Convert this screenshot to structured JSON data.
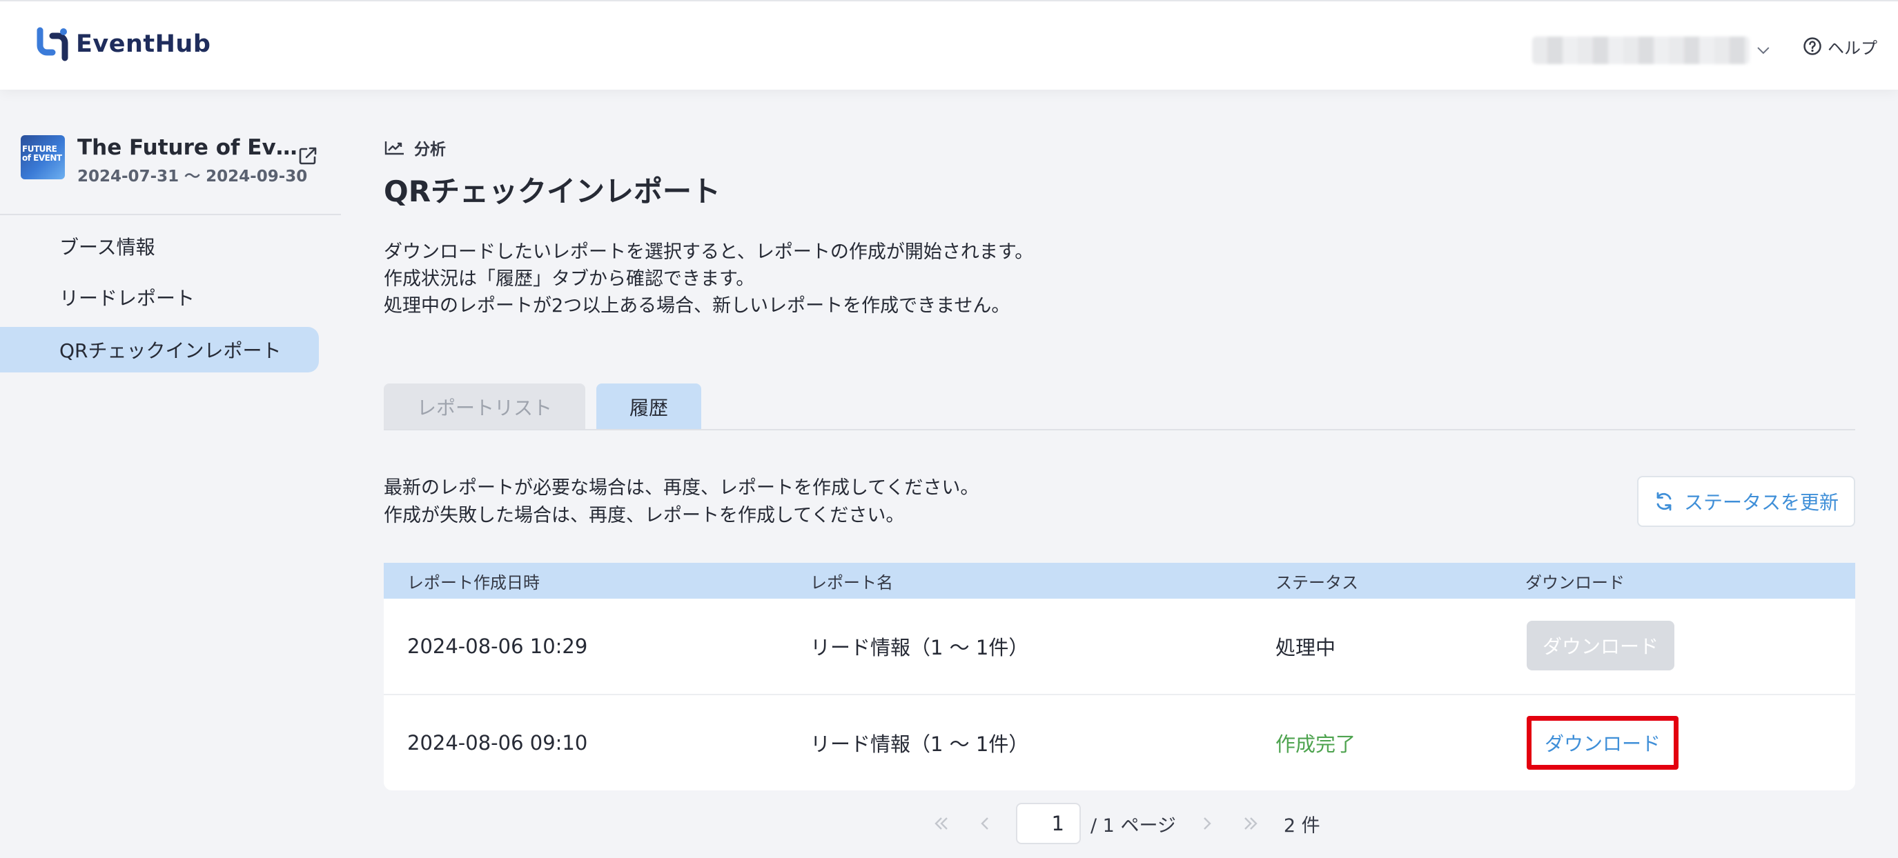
{
  "app": {
    "name": "EventHub"
  },
  "header": {
    "account_label": "",
    "help_label": "ヘルプ"
  },
  "event": {
    "thumbnail_text": "FUTURE of EVENT",
    "title": "The Future of Events",
    "dates": "2024-07-31 〜 2024-09-30"
  },
  "sidebar": {
    "items": [
      {
        "label": "ブース情報",
        "active": false
      },
      {
        "label": "リードレポート",
        "active": false
      },
      {
        "label": "QRチェックインレポート",
        "active": true
      }
    ]
  },
  "breadcrumb": {
    "label": "分析"
  },
  "page": {
    "title": "QRチェックインレポート",
    "description": [
      "ダウンロードしたいレポートを選択すると、レポートの作成が開始されます。",
      "作成状況は「履歴」タブから確認できます。",
      "処理中のレポートが2つ以上ある場合、新しいレポートを作成できません。"
    ]
  },
  "tabs": [
    {
      "label": "レポートリスト",
      "active": false
    },
    {
      "label": "履歴",
      "active": true
    }
  ],
  "history": {
    "notes": [
      "最新のレポートが必要な場合は、再度、レポートを作成してください。",
      "作成が失敗した場合は、再度、レポートを作成してください。"
    ],
    "refresh_label": "ステータスを更新"
  },
  "table": {
    "columns": [
      "レポート作成日時",
      "レポート名",
      "ステータス",
      "ダウンロード"
    ],
    "rows": [
      {
        "created": "2024-08-06 10:29",
        "name": "リード情報（1 〜 1件）",
        "status": "処理中",
        "download": "ダウンロード",
        "download_enabled": false
      },
      {
        "created": "2024-08-06 09:10",
        "name": "リード情報（1 〜 1件）",
        "status": "作成完了",
        "download": "ダウンロード",
        "download_enabled": true
      }
    ]
  },
  "pagination": {
    "current_page": "1",
    "page_suffix": "/ 1 ページ",
    "total": "2 件"
  },
  "colors": {
    "accent": "#3f8fd8",
    "active_bg": "#c7def7",
    "success": "#4ea34f",
    "highlight": "#e3000f"
  }
}
